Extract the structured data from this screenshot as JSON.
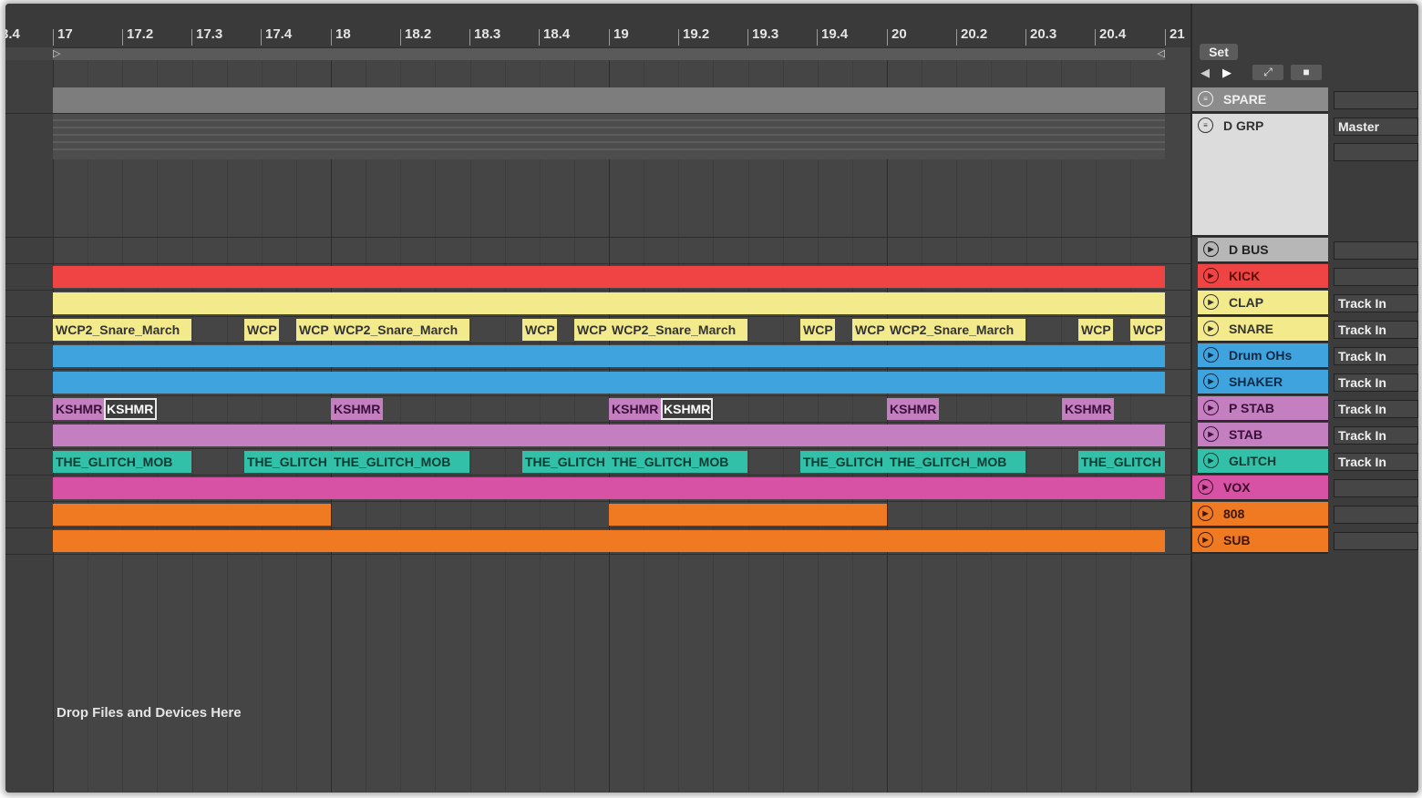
{
  "ruler": {
    "ticks": [
      "3.4",
      "17",
      "17.2",
      "17.3",
      "17.4",
      "18",
      "18.2",
      "18.3",
      "18.4",
      "19",
      "19.2",
      "19.3",
      "19.4",
      "20",
      "20.2",
      "20.3",
      "20.4",
      "21"
    ]
  },
  "toolbar": {
    "set_label": "Set",
    "back_icon": "arrow-left-icon",
    "forward_icon": "arrow-right-icon",
    "expand_icon": "expand-icon",
    "lock_icon": "lock-icon"
  },
  "tracks": [
    {
      "name": "SPARE",
      "icon": "group-fold-icon",
      "color": "#8c8c8c",
      "text": "#f0f0f0",
      "io": ""
    },
    {
      "name": "D GRP",
      "icon": "group-fold-icon",
      "color": "#dcdcdc",
      "text": "#333333",
      "io": "Master"
    },
    {
      "name": "D BUS",
      "icon": "play-icon",
      "color": "#b7b7b7",
      "text": "#222222",
      "io": ""
    },
    {
      "name": "KICK",
      "icon": "play-icon",
      "color": "#ef4444",
      "text": "#5a0d0d",
      "io": ""
    },
    {
      "name": "CLAP",
      "icon": "play-icon",
      "color": "#f2ea8b",
      "text": "#333333",
      "io": "Track In"
    },
    {
      "name": "SNARE",
      "icon": "play-icon",
      "color": "#f2ea8b",
      "text": "#333333",
      "io": "Track In"
    },
    {
      "name": "Drum OHs",
      "icon": "play-icon",
      "color": "#3fa3de",
      "text": "#0d2a45",
      "io": "Track In"
    },
    {
      "name": "SHAKER",
      "icon": "play-icon",
      "color": "#3fa3de",
      "text": "#0d2a45",
      "io": "Track In"
    },
    {
      "name": "P STAB",
      "icon": "play-icon",
      "color": "#c37fc0",
      "text": "#3a0f38",
      "io": "Track In"
    },
    {
      "name": "STAB",
      "icon": "play-icon",
      "color": "#c37fc0",
      "text": "#3a0f38",
      "io": "Track In"
    },
    {
      "name": "GLITCH",
      "icon": "play-icon",
      "color": "#33c0a8",
      "text": "#0b3b33",
      "io": "Track In"
    },
    {
      "name": "VOX",
      "icon": "play-icon",
      "color": "#d752a4",
      "text": "#3b0a28",
      "io": ""
    },
    {
      "name": "808",
      "icon": "play-icon",
      "color": "#f07a22",
      "text": "#3b1700",
      "io": ""
    },
    {
      "name": "SUB",
      "icon": "play-icon",
      "color": "#f07a22",
      "text": "#3b1700",
      "io": ""
    }
  ],
  "clips": {
    "snare": [
      "WCP2_Snare_March",
      "WCP",
      "WCP",
      "WCP2_Snare_March",
      "WCP",
      "WCP",
      "WCP2_Snare_March",
      "WCP",
      "WCP",
      "WCP2_Snare_March",
      "WCP",
      "WCP"
    ],
    "pstab": [
      "KSHMR",
      "KSHMR",
      "KSHMR",
      "KSHMR",
      "KSHMR",
      "KSHMR",
      "KSHMR"
    ],
    "glitch": [
      "THE_GLITCH_MOB",
      "THE_GLITCH",
      "THE_GLITCH_MOB",
      "THE_GLITCH",
      "THE_GLITCH_MOB",
      "THE_GLITCH",
      "THE_GLITCH_MOB",
      "THE_GLITCH"
    ]
  },
  "status": {
    "drop_message": "Drop Files and Devices Here"
  }
}
